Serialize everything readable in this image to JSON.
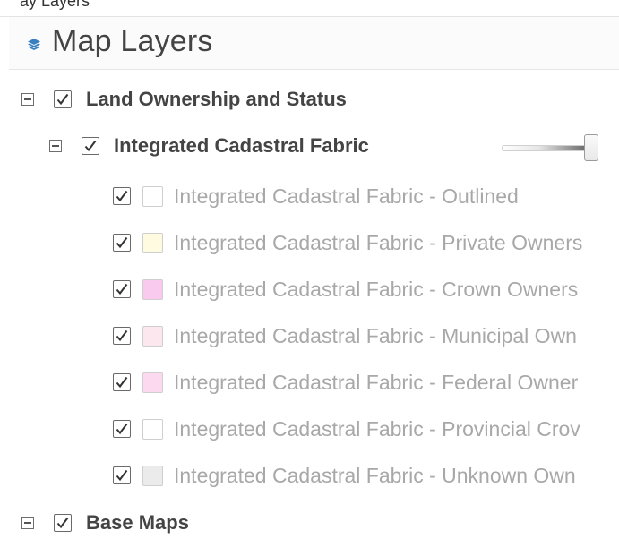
{
  "top_partial_text": "ay Layers",
  "header": {
    "title": "Map Layers",
    "icon": "layers-icon"
  },
  "groups": [
    {
      "label": "Land Ownership and Status",
      "checked": true
    },
    {
      "label": "Base Maps",
      "checked": true
    }
  ],
  "subgroup": {
    "label": "Integrated Cadastral Fabric",
    "checked": true,
    "opacity_percent": 100
  },
  "layers": [
    {
      "label": "Integrated Cadastral Fabric - Outlined",
      "swatch": "#ffffff",
      "checked": true
    },
    {
      "label": "Integrated Cadastral Fabric - Private Owners",
      "swatch": "#fffbe0",
      "checked": true
    },
    {
      "label": "Integrated Cadastral Fabric - Crown Owners",
      "swatch": "#f9c9ee",
      "checked": true
    },
    {
      "label": "Integrated Cadastral Fabric - Municipal Own",
      "swatch": "#fde7ef",
      "checked": true
    },
    {
      "label": "Integrated Cadastral Fabric - Federal Owner",
      "swatch": "#fcd9ee",
      "checked": true
    },
    {
      "label": "Integrated Cadastral Fabric - Provincial Crov",
      "swatch": "#ffffff",
      "checked": true
    },
    {
      "label": "Integrated Cadastral Fabric - Unknown Own",
      "swatch": "#ebebeb",
      "checked": true
    }
  ]
}
